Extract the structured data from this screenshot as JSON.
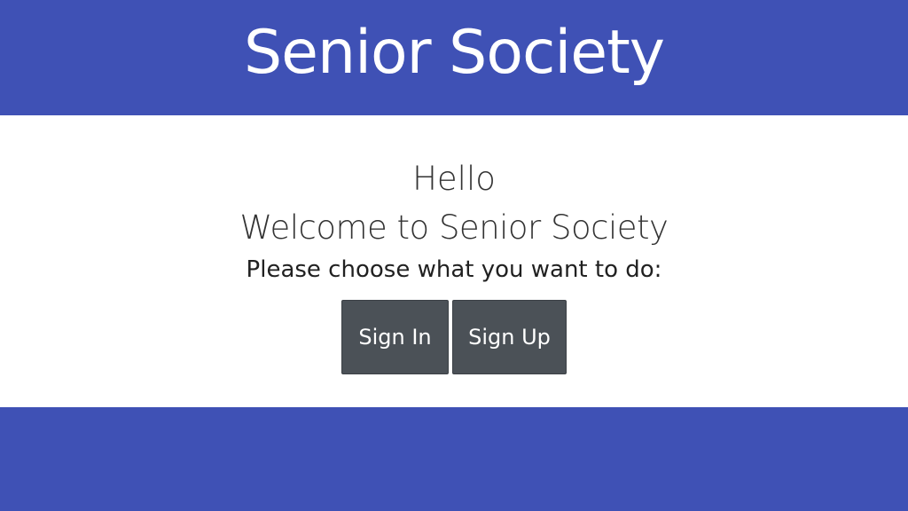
{
  "header": {
    "title": "Senior Society"
  },
  "main": {
    "greeting": "Hello",
    "welcome": "Welcome to Senior Society",
    "prompt": "Please choose what you want to do:",
    "buttons": {
      "sign_in": "Sign In",
      "sign_up": "Sign Up"
    }
  },
  "colors": {
    "brand": "#3f51b5",
    "button": "#4b5157",
    "background": "#ffffff"
  }
}
